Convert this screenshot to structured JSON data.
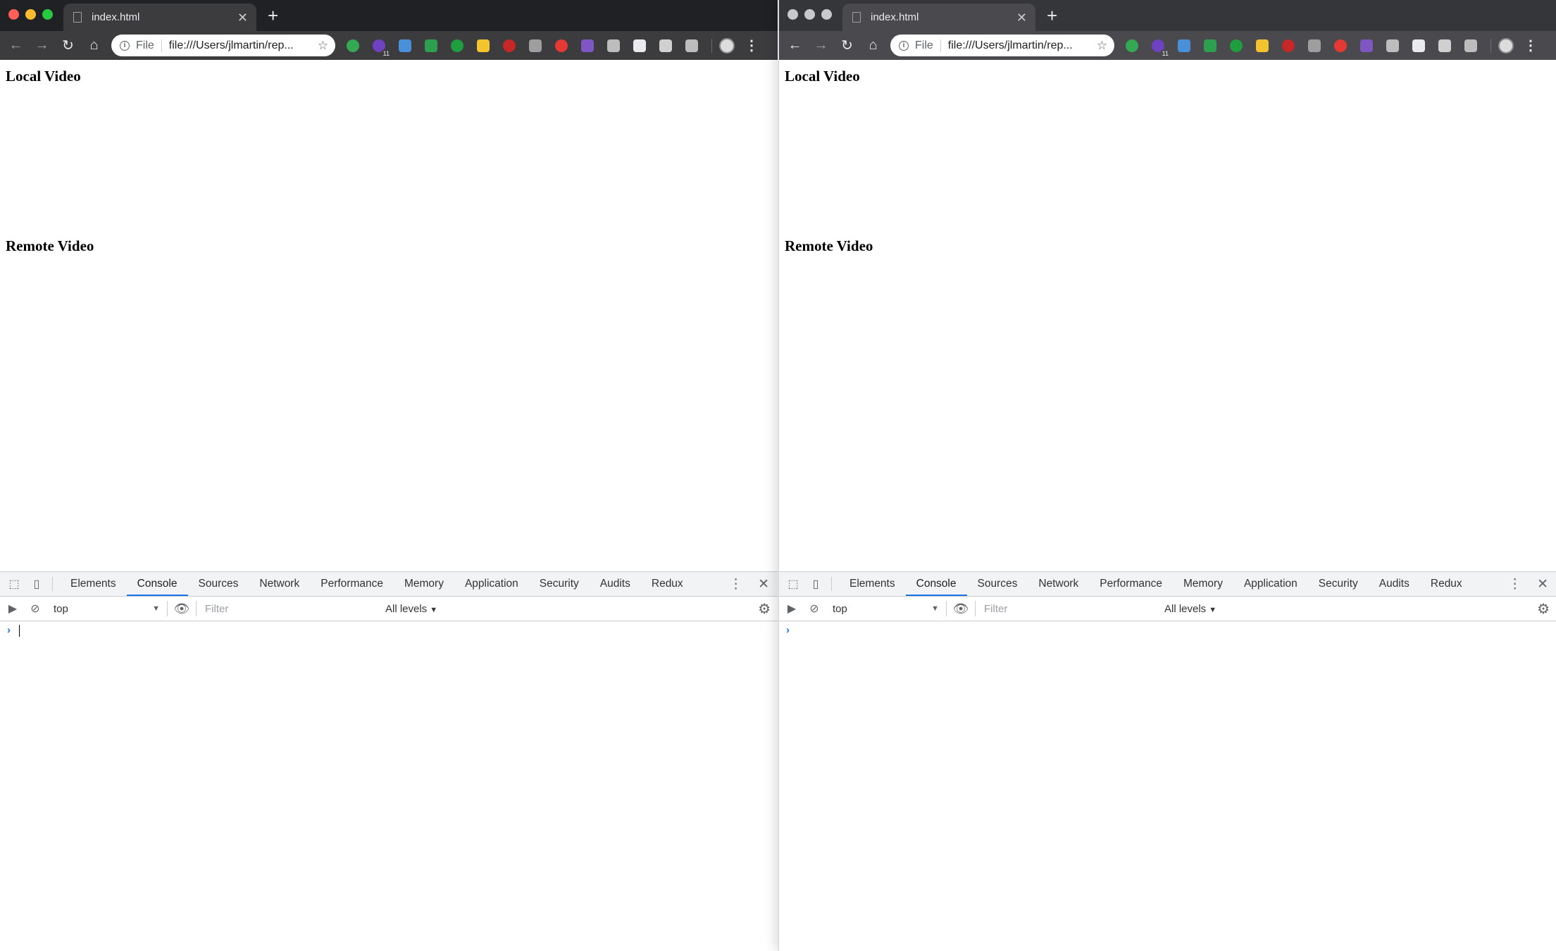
{
  "windows": [
    {
      "tab_title": "index.html",
      "omnibox": {
        "scheme": "File",
        "url": "file:///Users/jlmartin/rep..."
      },
      "extension_badge": "11",
      "page": {
        "local_heading": "Local Video",
        "remote_heading": "Remote Video"
      },
      "devtools": {
        "tabs": [
          "Elements",
          "Console",
          "Sources",
          "Network",
          "Performance",
          "Memory",
          "Application",
          "Security",
          "Audits",
          "Redux"
        ],
        "selected_tab": "Console",
        "context": "top",
        "filter_placeholder": "Filter",
        "levels": "All levels"
      }
    },
    {
      "tab_title": "index.html",
      "omnibox": {
        "scheme": "File",
        "url": "file:///Users/jlmartin/rep..."
      },
      "extension_badge": "11",
      "page": {
        "local_heading": "Local Video",
        "remote_heading": "Remote Video"
      },
      "devtools": {
        "tabs": [
          "Elements",
          "Console",
          "Sources",
          "Network",
          "Performance",
          "Memory",
          "Application",
          "Security",
          "Audits",
          "Redux"
        ],
        "selected_tab": "Console",
        "context": "top",
        "filter_placeholder": "Filter",
        "levels": "All levels"
      }
    }
  ],
  "colors": {
    "accent": "#1a73e8",
    "extensions": [
      "#34a853",
      "#6f42c1",
      "#4a90d9",
      "#2e9e4f",
      "#1e9e3e",
      "#f4c430",
      "#c62828",
      "#9e9e9e",
      "#e53935",
      "#7e57c2",
      "#bdbdbd",
      "#e8eaed",
      "#d0d0d0",
      "#bdbdbd"
    ]
  }
}
